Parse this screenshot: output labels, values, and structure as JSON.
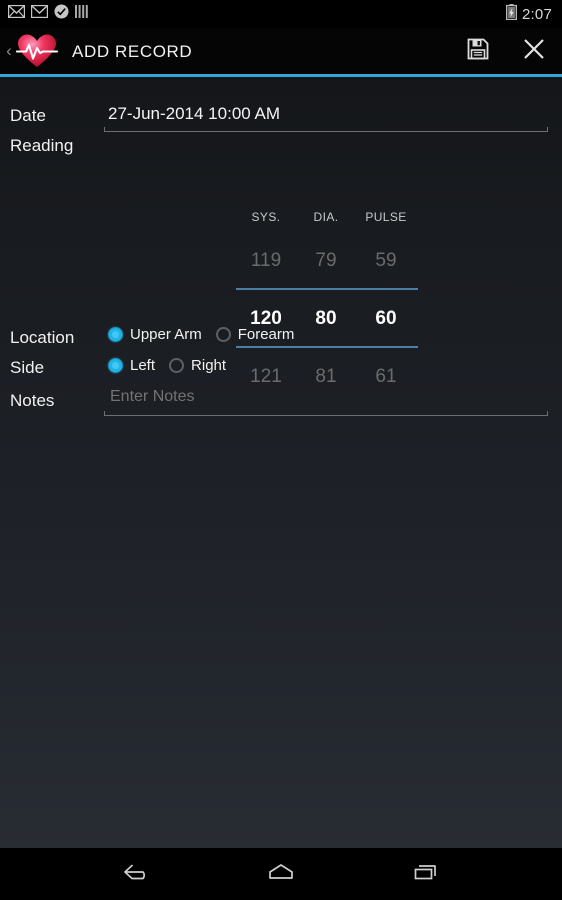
{
  "status_bar": {
    "icons": [
      "gmail-icon",
      "email-icon",
      "check-circle-icon",
      "bars-icon"
    ],
    "battery_icon": "battery-charging-icon",
    "time": "2:07"
  },
  "action_bar": {
    "back_chevron": "‹",
    "logo_icon": "heart-pulse-logo",
    "title": "ADD RECORD",
    "save_icon": "save-floppy-icon",
    "close_icon": "close-x-icon"
  },
  "form": {
    "date": {
      "label": "Date",
      "value": "27-Jun-2014 10:00 AM"
    },
    "reading": {
      "label": "Reading",
      "columns": [
        "SYS.",
        "DIA.",
        "PULSE"
      ],
      "previous": [
        "119",
        "79",
        "59"
      ],
      "selected": [
        "120",
        "80",
        "60"
      ],
      "next": [
        "121",
        "81",
        "61"
      ]
    },
    "location": {
      "label": "Location",
      "options": [
        {
          "label": "Upper Arm",
          "selected": true
        },
        {
          "label": "Forearm",
          "selected": false
        }
      ]
    },
    "side": {
      "label": "Side",
      "options": [
        {
          "label": "Left",
          "selected": true
        },
        {
          "label": "Right",
          "selected": false
        }
      ]
    },
    "notes": {
      "label": "Notes",
      "value": "",
      "placeholder": "Enter Notes"
    }
  },
  "nav_bar": {
    "back_icon": "nav-back-icon",
    "home_icon": "nav-home-icon",
    "recents_icon": "nav-recents-icon"
  },
  "colors": {
    "accent_blue": "#2fa8dd",
    "picker_line": "#4b80a6",
    "radio_on": "#1fb3e8",
    "heart_red": "#e8214a",
    "background": "#1d2026"
  }
}
